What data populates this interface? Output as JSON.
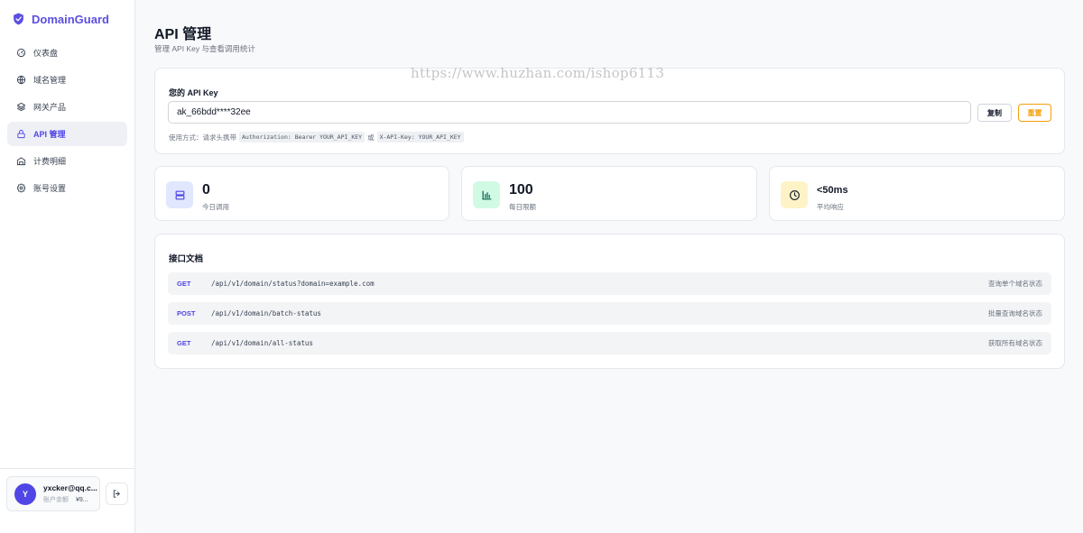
{
  "app": {
    "name": "DomainGuard"
  },
  "colors": {
    "accent": "#4f46e5",
    "warning": "#f59e0b"
  },
  "sidebar": {
    "items": [
      {
        "label": "仪表盘",
        "icon": "gauge-icon"
      },
      {
        "label": "域名管理",
        "icon": "globe-icon"
      },
      {
        "label": "网关产品",
        "icon": "layers-icon"
      },
      {
        "label": "API 管理",
        "icon": "lock-icon",
        "active": true
      },
      {
        "label": "计费明细",
        "icon": "billing-icon"
      },
      {
        "label": "账号设置",
        "icon": "gear-icon"
      }
    ]
  },
  "user": {
    "initial": "Y",
    "email": "yxcker@qq.c...",
    "balance_label": "账户余额",
    "balance": "¥9..."
  },
  "page": {
    "title": "API 管理",
    "subtitle": "管理 API Key 与查看调用统计"
  },
  "api_key": {
    "title": "您的 API Key",
    "value": "ak_66bdd****32ee",
    "copy_label": "复制",
    "reset_label": "重置",
    "usage_prefix": "使用方式：请求头携带",
    "usage_code1": "Authorization: Bearer YOUR_API_KEY",
    "usage_or": "或",
    "usage_code2": "X-API-Key: YOUR_API_KEY"
  },
  "stats": [
    {
      "value": "0",
      "label": "今日调用",
      "icon": "server-icon"
    },
    {
      "value": "100",
      "label": "每日限额",
      "icon": "bar-chart-icon"
    },
    {
      "value": "<50ms",
      "label": "平均响应",
      "icon": "clock-icon"
    }
  ],
  "docs": {
    "title": "接口文档",
    "endpoints": [
      {
        "method": "GET",
        "path": "/api/v1/domain/status?domain=example.com",
        "desc": "查询单个域名状态"
      },
      {
        "method": "POST",
        "path": "/api/v1/domain/batch-status",
        "desc": "批量查询域名状态"
      },
      {
        "method": "GET",
        "path": "/api/v1/domain/all-status",
        "desc": "获取所有域名状态"
      }
    ]
  },
  "watermark": "https://www.huzhan.com/ishop6113"
}
